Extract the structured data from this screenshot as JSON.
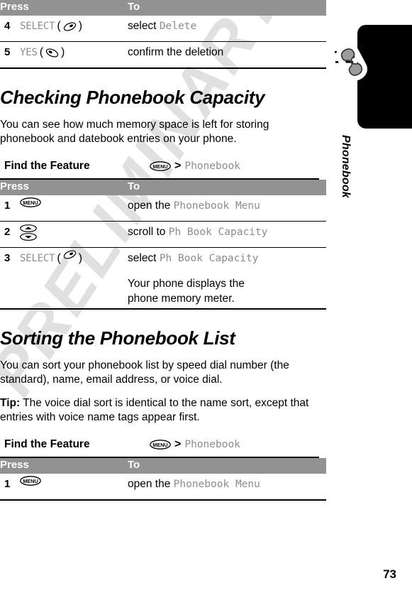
{
  "page": {
    "number": "73",
    "watermark": "PRELIMINARY"
  },
  "sidebar": {
    "label": "Phonebook",
    "icon": "phone-handset-icon"
  },
  "table_top": {
    "header": {
      "press": "Press",
      "to": "To"
    },
    "rows": [
      {
        "num": "4",
        "press_label": "SELECT",
        "press_icon": "softkey-right-icon",
        "to_plain": "select ",
        "to_mono": "Delete"
      },
      {
        "num": "5",
        "press_label": "YES",
        "press_icon": "softkey-left-icon",
        "to_plain": "confirm the deletion",
        "to_mono": ""
      }
    ]
  },
  "section_capacity": {
    "heading": "Checking Phonebook Capacity",
    "paragraph": "You can see how much memory space is left for storing phonebook and datebook entries on your phone.",
    "find_the_feature": {
      "label": "Find the Feature",
      "icon": "menu-key-icon",
      "separator": ">",
      "path": "Phonebook"
    },
    "table": {
      "header": {
        "press": "Press",
        "to": "To"
      },
      "rows": [
        {
          "num": "1",
          "press_label": "",
          "press_icon": "menu-key-icon",
          "to_plain": "open the ",
          "to_mono": "Phonebook Menu"
        },
        {
          "num": "2",
          "press_label": "",
          "press_icon": "scroll-up-down-key-icon",
          "to_plain": "scroll to ",
          "to_mono": "Ph Book Capacity"
        },
        {
          "num": "3",
          "press_label": "SELECT",
          "press_icon": "softkey-right-icon",
          "to_plain": "select ",
          "to_mono": "Ph Book Capacity",
          "to_note": "Your phone displays the phone memory meter."
        }
      ]
    }
  },
  "section_sorting": {
    "heading": "Sorting the Phonebook List",
    "paragraph": "You can sort your phonebook list by speed dial number (the standard), name, email address, or voice dial.",
    "tip_label": "Tip:",
    "tip_text": " The voice dial sort is identical to the name sort, except that entries with voice name tags appear first.",
    "find_the_feature": {
      "label": "Find the Feature",
      "icon": "menu-key-icon",
      "separator": ">",
      "path": "Phonebook"
    },
    "table": {
      "header": {
        "press": "Press",
        "to": "To"
      },
      "rows": [
        {
          "num": "1",
          "press_label": "",
          "press_icon": "menu-key-icon",
          "to_plain": "open the ",
          "to_mono": "Phonebook Menu"
        }
      ]
    }
  },
  "colors": {
    "header_bar": "#929292",
    "mono_gray": "#8c8c8c",
    "watermark": "#e0e0e0",
    "tab_black": "#000000",
    "handset_gray": "#9b9b9b"
  }
}
